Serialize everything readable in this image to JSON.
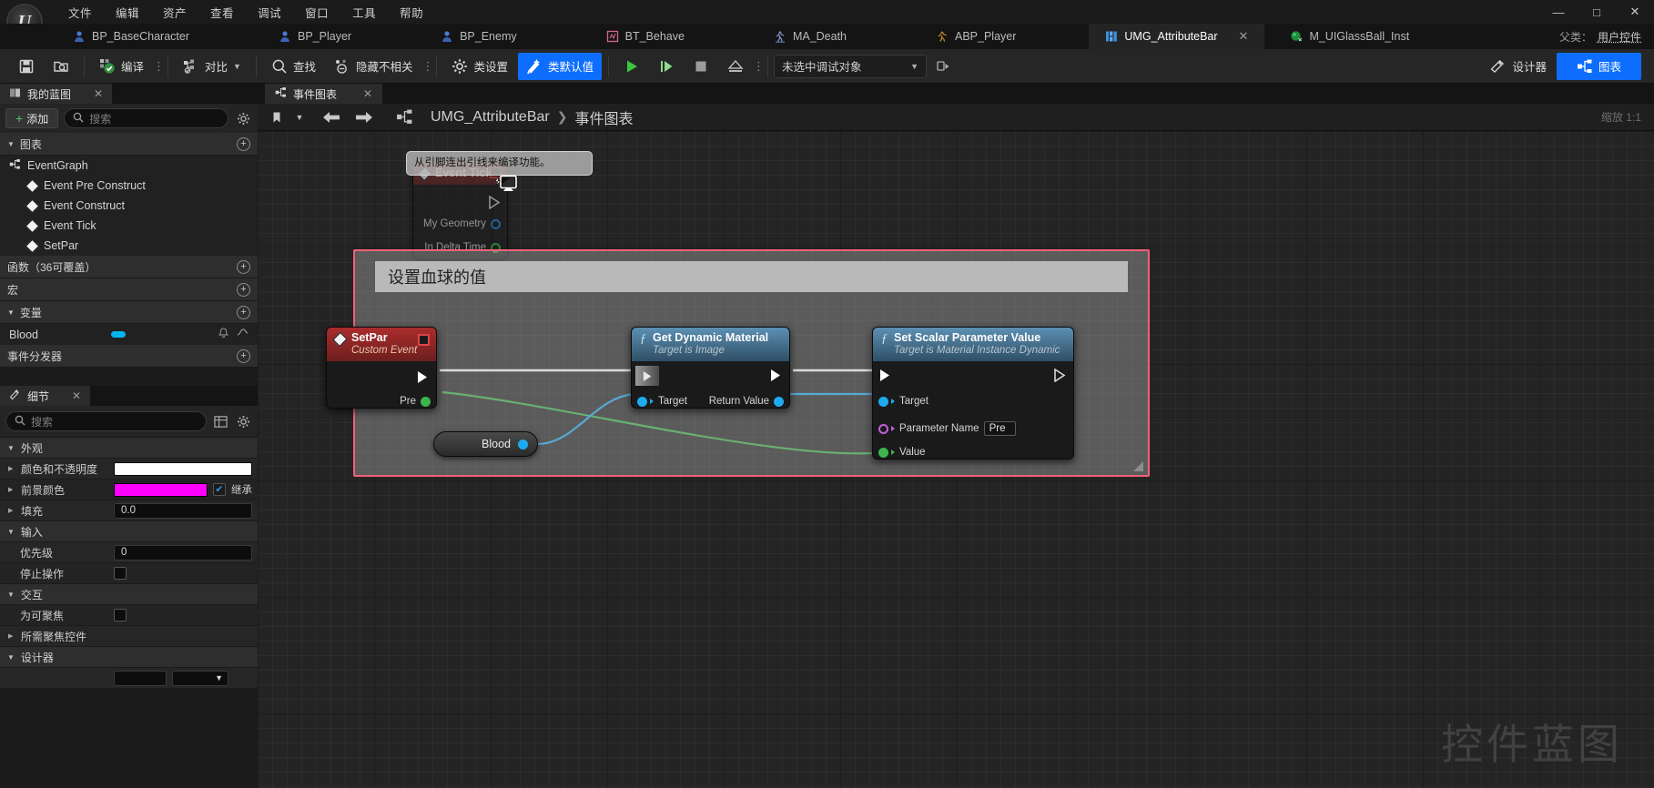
{
  "menu": {
    "items": [
      "文件",
      "编辑",
      "资产",
      "查看",
      "调试",
      "窗口",
      "工具",
      "帮助"
    ]
  },
  "window_controls": {
    "minimize": "—",
    "maximize": "□",
    "close": "✕"
  },
  "asset_tabs": [
    {
      "label": "BP_BaseCharacter",
      "icon": "blueprint-character-icon",
      "active": false
    },
    {
      "label": "BP_Player",
      "icon": "blueprint-character-icon",
      "active": false
    },
    {
      "label": "BP_Enemy",
      "icon": "blueprint-character-icon",
      "active": false
    },
    {
      "label": "BT_Behave",
      "icon": "behavior-tree-icon",
      "active": false
    },
    {
      "label": "MA_Death",
      "icon": "anim-montage-icon",
      "active": false
    },
    {
      "label": "ABP_Player",
      "icon": "anim-blueprint-icon",
      "active": false
    },
    {
      "label": "UMG_AttributeBar",
      "icon": "widget-blueprint-icon",
      "active": true,
      "close": "✕"
    },
    {
      "label": "M_UIGlassBall_Inst",
      "icon": "material-instance-icon",
      "active": false
    }
  ],
  "parent_class": {
    "label": "父类：",
    "value": "用户控件"
  },
  "toolbar": {
    "save": "保存",
    "browse": "浏览",
    "compile": "编译",
    "diff": "对比",
    "find": "查找",
    "hide_unrelated": "隐藏不相关",
    "class_settings": "类设置",
    "class_defaults": "类默认值",
    "play": "播放",
    "step": "单步",
    "stop": "停止",
    "eject": "弹出",
    "debug_object": "未选中调试对象",
    "designer": "设计器",
    "graph": "图表"
  },
  "my_blueprint": {
    "tab_title": "我的蓝图",
    "tab_close": "✕",
    "add_button": "添加",
    "search_placeholder": "搜索",
    "sections": [
      {
        "title": "图表",
        "collapsible": true,
        "items": [
          {
            "label": "EventGraph",
            "type": "graph",
            "indent": 0
          },
          {
            "label": "Event Pre Construct",
            "type": "event",
            "indent": 1
          },
          {
            "label": "Event Construct",
            "type": "event",
            "indent": 1
          },
          {
            "label": "Event Tick",
            "type": "event",
            "indent": 1
          },
          {
            "label": "SetPar",
            "type": "event",
            "indent": 1
          }
        ]
      },
      {
        "title": "函数（36可覆盖）",
        "collapsible": false,
        "items": []
      },
      {
        "title": "宏",
        "collapsible": false,
        "items": []
      },
      {
        "title": "变量",
        "collapsible": true,
        "variables": [
          {
            "name": "Blood",
            "type_color": "#00b4ee"
          }
        ]
      },
      {
        "title": "事件分发器",
        "collapsible": false,
        "items": []
      }
    ]
  },
  "details": {
    "tab_title": "细节",
    "tab_close": "✕",
    "search_placeholder": "搜索",
    "categories": [
      {
        "title": "外观",
        "rows": [
          {
            "label": "颜色和不透明度",
            "kind": "color",
            "value": "#ffffff",
            "expandable": true
          },
          {
            "label": "前景颜色",
            "kind": "color-inherit",
            "value": "#ff00ff",
            "expandable": true,
            "inherit_label": "继承",
            "inherit_checked": true
          },
          {
            "label": "填充",
            "kind": "number",
            "value": "0.0",
            "expandable": true
          }
        ]
      },
      {
        "title": "输入",
        "rows": [
          {
            "label": "优先级",
            "kind": "number",
            "value": "0",
            "expandable": false
          },
          {
            "label": "停止操作",
            "kind": "checkbox",
            "checked": false,
            "expandable": false
          }
        ]
      },
      {
        "title": "交互",
        "rows": [
          {
            "label": "为可聚焦",
            "kind": "checkbox",
            "checked": false,
            "expandable": false
          },
          {
            "label": "所需聚焦控件",
            "kind": "empty",
            "expandable": true
          }
        ]
      },
      {
        "title": "设计器",
        "rows": []
      }
    ]
  },
  "graph_panel": {
    "tab_title": "事件图表",
    "tab_close": "✕",
    "breadcrumb": {
      "root": "UMG_AttributeBar",
      "separator": "❯",
      "leaf": "事件图表"
    },
    "zoom_label": "缩放 1:1",
    "tooltip": "从引脚连出引线来编译功能。",
    "watermark": "控件蓝图"
  },
  "nodes": {
    "event_tick": {
      "title": "Event Tick",
      "pins": [
        {
          "label": "My Geometry",
          "color": "#2f7fd8",
          "shape": "ring"
        },
        {
          "label": "In Delta Time",
          "color": "#3cb54a",
          "shape": "ring"
        }
      ]
    },
    "comment": {
      "text": "设置血球的值",
      "border_color": "#f2607a"
    },
    "set_par": {
      "title": "SetPar",
      "subtitle": "Custom Event",
      "out_pins": [
        {
          "label": "Pre",
          "color": "#3cb54a",
          "shape": "dot"
        }
      ]
    },
    "get_dynamic_material": {
      "title": "Get Dynamic Material",
      "subtitle": "Target is Image",
      "in_pins": [
        {
          "label": "Target",
          "color": "#1eaaf0",
          "shape": "dot"
        }
      ],
      "out_pins": [
        {
          "label": "Return Value",
          "color": "#1eaaf0",
          "shape": "dot"
        }
      ]
    },
    "set_scalar_parameter_value": {
      "title": "Set Scalar Parameter Value",
      "subtitle": "Target is Material Instance Dynamic",
      "in_pins": [
        {
          "label": "Target",
          "color": "#1eaaf0",
          "shape": "dot"
        },
        {
          "label": "Parameter Name",
          "color": "#c060d8",
          "shape": "ring",
          "field_value": "Pre"
        },
        {
          "label": "Value",
          "color": "#3cb54a",
          "shape": "dot"
        }
      ]
    },
    "blood_variable": {
      "label": "Blood",
      "pin_color": "#1eaaf0"
    }
  },
  "colors": {
    "accent_blue": "#0d6efd",
    "exec_white": "#ffffff",
    "wire_green": "#3cb54a",
    "wire_cyan": "#1eaaf0",
    "comment_pink": "#f2607a"
  }
}
